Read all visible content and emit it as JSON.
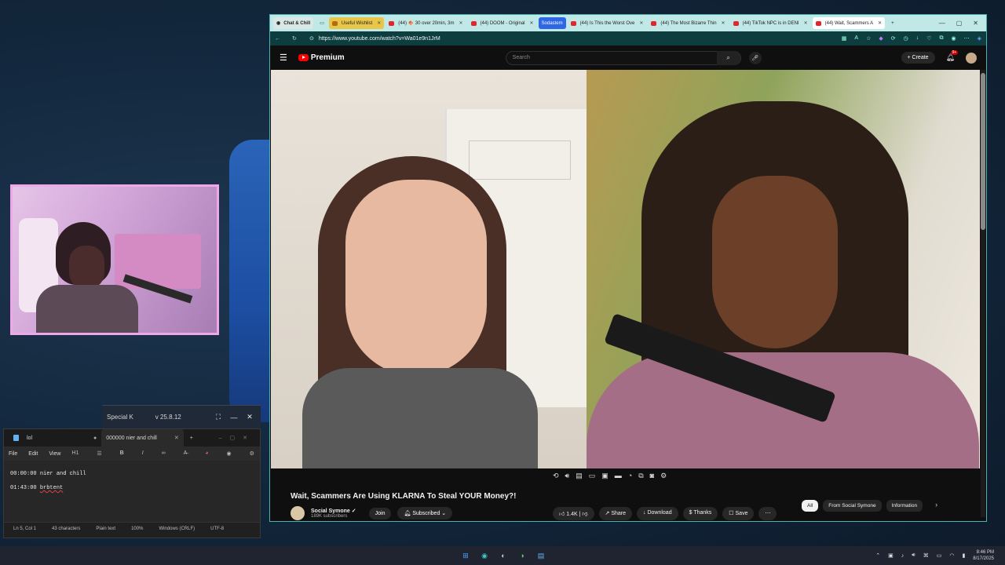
{
  "special_k": {
    "title": "Special K",
    "version": "v 25.8.12"
  },
  "notepad": {
    "tabs": [
      {
        "label": "lol"
      },
      {
        "label": "000000 nier and chill"
      }
    ],
    "menu": [
      "File",
      "Edit",
      "View"
    ],
    "heading_level": "H1",
    "lines": [
      {
        "time": "00:00:00",
        "text": "nier and chill"
      },
      {
        "time": "01:43:00",
        "text": "brbtent"
      }
    ],
    "status": {
      "position": "Ln 5, Col 1",
      "characters": "43 characters",
      "format": "Plain text",
      "zoom": "100%",
      "line_ending": "Windows (CRLF)",
      "encoding": "UTF-8"
    }
  },
  "browser": {
    "group_tab": "Chat & Chill",
    "tabs": [
      {
        "label": "Useful Wishlist",
        "style": "yellow"
      },
      {
        "label": "(44) 🍖 30 over 20min, 3m"
      },
      {
        "label": "(44) DOOM - Original"
      },
      {
        "label": "Sodastem",
        "style": "blue"
      },
      {
        "label": "(44) Is This the Worst Ove"
      },
      {
        "label": "(44) The Most Bizarre Thin"
      },
      {
        "label": "(44) TikTok NPC is in DENI"
      },
      {
        "label": "(44) Wait, Scammers A",
        "style": "active"
      }
    ],
    "url": "https://www.youtube.com/watch?v=Wa01e9n1JrM"
  },
  "youtube": {
    "logo_text": "Premium",
    "search_placeholder": "Search",
    "create_label": "Create",
    "notifications": "9+",
    "video_title": "Wait, Scammers Are Using KLARNA To Steal YOUR Money?!",
    "channel_name": "Social Symone",
    "subscribers": "189K subscribers",
    "join_label": "Join",
    "subscribed_label": "Subscribed",
    "likes": "1.4K",
    "share_label": "Share",
    "download_label": "Download",
    "thanks_label": "Thanks",
    "save_label": "Save",
    "chips": [
      "All",
      "From Social Symone",
      "Information"
    ]
  },
  "taskbar": {
    "time": "8:46 PM",
    "date": "8/17/2025"
  },
  "colors": {
    "accent_teal": "#4ab5b0",
    "youtube_red": "#ff0000",
    "webcam_border": "#f0a7e8"
  }
}
